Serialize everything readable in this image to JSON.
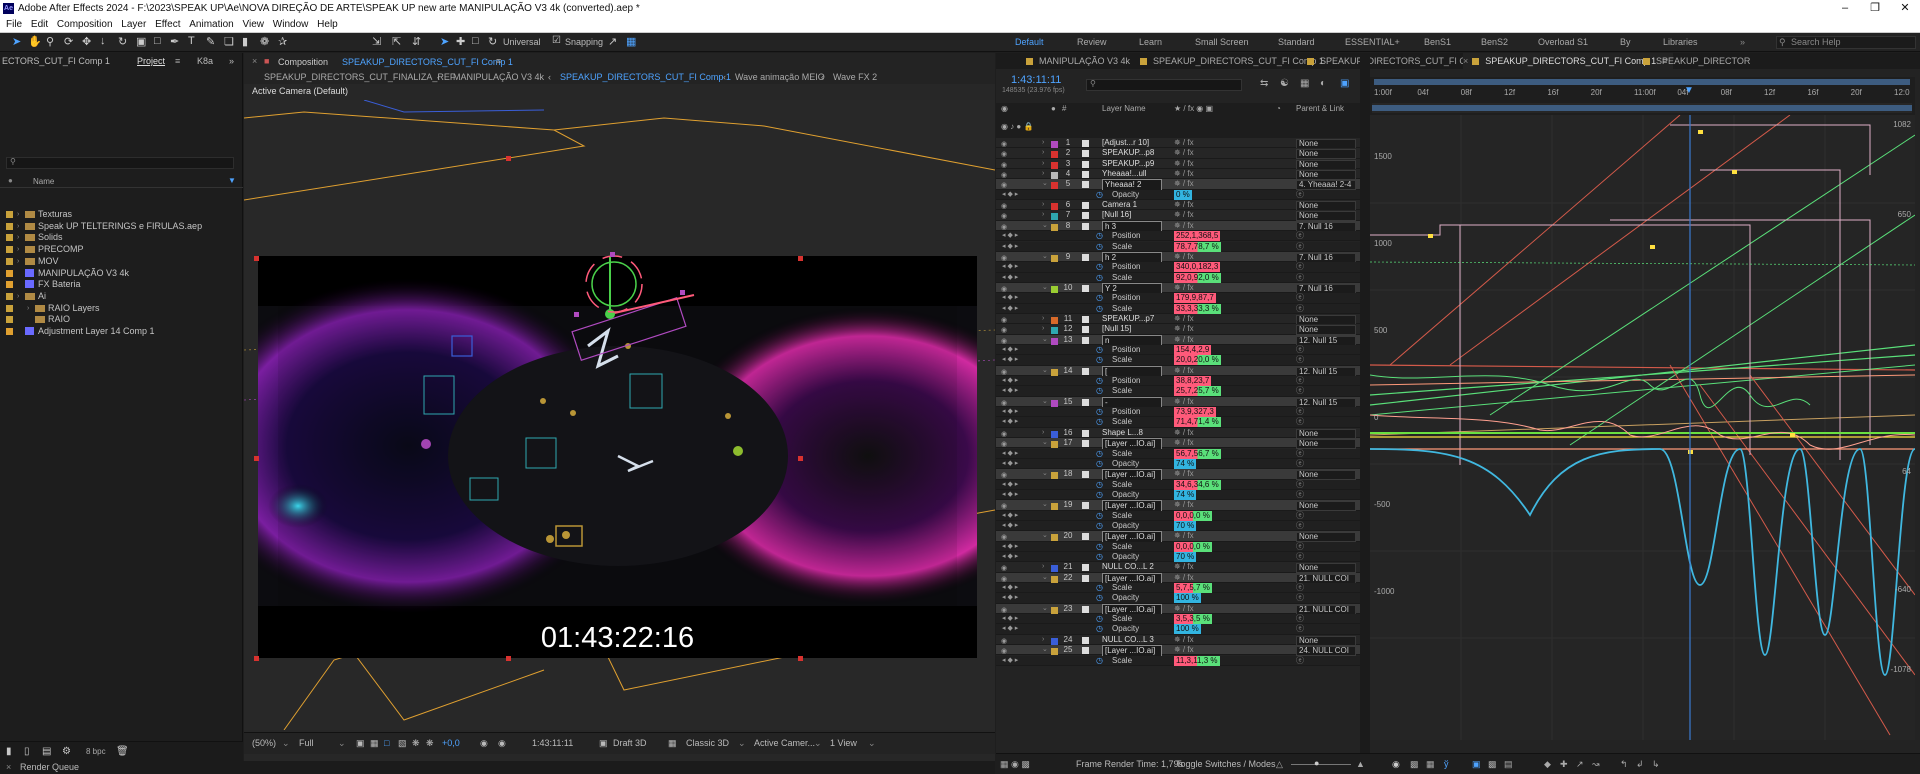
{
  "app": {
    "title": "Adobe After Effects 2024 - F:\\2023\\SPEAK UP\\Ae\\NOVA DIREÇÃO DE ARTE\\SPEAK UP new arte MANIPULAÇÃO V3 4k (converted).aep *",
    "logo": "Ae"
  },
  "menu": [
    "File",
    "Edit",
    "Composition",
    "Layer",
    "Effect",
    "Animation",
    "View",
    "Window",
    "Help"
  ],
  "toolbar": {
    "universal": "Universal",
    "snapping": "Snapping",
    "workspaces": [
      "Default",
      "Review",
      "Learn",
      "Small Screen",
      "Standard",
      "ESSENTIAL+",
      "BenS1",
      "BenS2",
      "Overload S1",
      "By",
      "Libraries"
    ],
    "active_workspace": "Default",
    "search_placeholder": "Search Help"
  },
  "project": {
    "tab_left": "ECTORS_CUT_FI Comp 1",
    "tab_project": "Project",
    "tab_k8a": "K8a",
    "col_name": "Name",
    "items": [
      {
        "name": "Texturas",
        "type": "folder",
        "color": "#c9a23b",
        "indent": 0
      },
      {
        "name": "Speak UP TELTERINGS e FIRULAS.aep",
        "type": "folder",
        "color": "#c9a23b",
        "indent": 0
      },
      {
        "name": "Solids",
        "type": "folder",
        "color": "#c9a23b",
        "indent": 0
      },
      {
        "name": "PRECOMP",
        "type": "folder",
        "color": "#c9a23b",
        "indent": 0
      },
      {
        "name": "MOV",
        "type": "folder",
        "color": "#c9a23b",
        "indent": 0
      },
      {
        "name": "MANIPULAÇÃO V3 4k",
        "type": "comp",
        "color": "#e0a030",
        "indent": 0
      },
      {
        "name": "FX Bateria",
        "type": "comp",
        "color": "#e0a030",
        "indent": 0
      },
      {
        "name": "Ai",
        "type": "folder",
        "color": "#c9a23b",
        "indent": 0
      },
      {
        "name": "RAIO Layers",
        "type": "folder",
        "color": "#c9a23b",
        "indent": 1
      },
      {
        "name": "RAIO",
        "type": "file",
        "color": "#c9a23b",
        "indent": 1
      },
      {
        "name": "Adjustment Layer 14 Comp 1",
        "type": "comp",
        "color": "#e0a030",
        "indent": 0
      }
    ],
    "bpc": "8 bpc"
  },
  "composition": {
    "header_prefix": "Composition",
    "header_name": "SPEAKUP_DIRECTORS_CUT_FI Comp 1",
    "breadcrumbs": [
      "SPEAKUP_DIRECTORS_CUT_FINALIZA_REF",
      "MANIPULAÇÃO V3 4k",
      "SPEAKUP_DIRECTORS_CUT_FI Comp 1",
      "Wave animação MEIO",
      "Wave FX 2"
    ],
    "active_breadcrumb": "SPEAKUP_DIRECTORS_CUT_FI Comp 1",
    "camera_label": "Active Camera (Default)",
    "timecode_overlay": "01:43:22:16",
    "zoom": "(50%)",
    "resolution": "Full",
    "exposure": "+0,0",
    "timecode": "1:43:11:11",
    "draft": "Draft 3D",
    "renderer": "Classic 3D",
    "camera": "Active Camer...",
    "views": "1 View"
  },
  "timeline": {
    "tabs": [
      "MANIPULAÇÃO V3 4k",
      "SPEAKUP_DIRECTORS_CUT_FI Comp 1",
      "SPEAKUP_DIRECTORS_CUT_FI Comp 1",
      "SPEAKUP_DIRECTORS_CUT_FI Comp 1",
      "SPEAKUP_DIRECTOR"
    ],
    "active_tab_index": 3,
    "current_time": "1:43:11:11",
    "frame_info": "148535 (23.976 fps)",
    "col_layer_name": "Layer Name",
    "col_parent": "Parent & Link",
    "ruler": [
      "1:00f",
      "04f",
      "08f",
      "12f",
      "16f",
      "20f",
      "11:00f",
      "04f",
      "08f",
      "12f",
      "16f",
      "20f",
      "12:0"
    ],
    "y_labels": [
      "1500",
      "1000",
      "500",
      "0",
      "-500",
      "-1000"
    ],
    "right_labels": [
      "1082",
      "650",
      "64",
      "-640",
      "-1078"
    ],
    "frame_render_time": "Frame Render Time: 1,79s",
    "toggle": "Toggle Switches / Modes"
  },
  "layers": [
    {
      "k": "L",
      "num": "1",
      "name": "[Adjust...r 10]",
      "color": "#b04ac0",
      "parent": "None"
    },
    {
      "k": "L",
      "num": "2",
      "name": "SPEAKUP...p8",
      "color": "#d8322f",
      "parent": "None"
    },
    {
      "k": "L",
      "num": "3",
      "name": "SPEAKUP...p9",
      "color": "#d8322f",
      "parent": "None"
    },
    {
      "k": "L",
      "num": "4",
      "name": "Yheaaa!...ull",
      "color": "#b8b8b8",
      "parent": "None"
    },
    {
      "k": "L",
      "num": "5",
      "name": "Yheaaa! 2",
      "color": "#d8322f",
      "parent": "4. Yheaaa! 2-4",
      "sel": true
    },
    {
      "k": "P",
      "name": "Opacity",
      "val": "0 %",
      "vc": "#32b4e0"
    },
    {
      "k": "L",
      "num": "6",
      "name": "Camera 1",
      "color": "#d8322f",
      "parent": "None"
    },
    {
      "k": "L",
      "num": "7",
      "name": "[Null 16]",
      "color": "#2fa8b0",
      "parent": "None"
    },
    {
      "k": "L",
      "num": "8",
      "name": "h 3",
      "color": "#c9a23b",
      "parent": "7. Null 16",
      "sel": true
    },
    {
      "k": "P",
      "name": "Position",
      "val": "252,1,368,5",
      "vc": "#ff5a7a"
    },
    {
      "k": "P",
      "name": "Scale",
      "val": "78,7,78,7 %",
      "vc": "#ff5a7a",
      "vc2": "#5ae07a"
    },
    {
      "k": "L",
      "num": "9",
      "name": "h 2",
      "color": "#c9a23b",
      "parent": "7. Null 16",
      "sel": true
    },
    {
      "k": "P",
      "name": "Position",
      "val": "340,0,182,3",
      "vc": "#ff5a7a"
    },
    {
      "k": "P",
      "name": "Scale",
      "val": "92,0,92,0 %",
      "vc": "#ff5a7a",
      "vc2": "#5ae07a"
    },
    {
      "k": "L",
      "num": "10",
      "name": "Y 2",
      "color": "#9acd32",
      "parent": "7. Null 16",
      "sel": true
    },
    {
      "k": "P",
      "name": "Position",
      "val": "179,9,87,7",
      "vc": "#ff5a7a"
    },
    {
      "k": "P",
      "name": "Scale",
      "val": "33,3,33,3 %",
      "vc": "#ff5a7a",
      "vc2": "#5ae07a"
    },
    {
      "k": "L",
      "num": "11",
      "name": "SPEAKUP...p7",
      "color": "#d86a2a",
      "parent": "None"
    },
    {
      "k": "L",
      "num": "12",
      "name": "[Null 15]",
      "color": "#2fa8b0",
      "parent": "None"
    },
    {
      "k": "L",
      "num": "13",
      "name": "n",
      "color": "#b04ac0",
      "parent": "12. Null 15",
      "sel": true
    },
    {
      "k": "P",
      "name": "Position",
      "val": "154,4,2,9",
      "vc": "#ff5a7a"
    },
    {
      "k": "P",
      "name": "Scale",
      "val": "20,0,20,0 %",
      "vc": "#ff5a7a",
      "vc2": "#5ae07a"
    },
    {
      "k": "L",
      "num": "14",
      "name": "[",
      "color": "#c9a23b",
      "parent": "12. Null 15",
      "sel": true
    },
    {
      "k": "P",
      "name": "Position",
      "val": "38,8,23,7",
      "vc": "#ff5a7a"
    },
    {
      "k": "P",
      "name": "Scale",
      "val": "25,7,25,7 %",
      "vc": "#ff5a7a",
      "vc2": "#5ae07a"
    },
    {
      "k": "L",
      "num": "15",
      "name": "-",
      "color": "#b04ac0",
      "parent": "12. Null 15",
      "sel": true
    },
    {
      "k": "P",
      "name": "Position",
      "val": "73,9,327,3",
      "vc": "#ff5a7a"
    },
    {
      "k": "P",
      "name": "Scale",
      "val": "71,4,71,4 %",
      "vc": "#ff5a7a",
      "vc2": "#5ae07a"
    },
    {
      "k": "L",
      "num": "16",
      "name": "Shape L...8",
      "color": "#3a5ed8",
      "parent": "None"
    },
    {
      "k": "L",
      "num": "17",
      "name": "[Layer ...IO.ai]",
      "color": "#c9a23b",
      "parent": "None",
      "sel": true
    },
    {
      "k": "P",
      "name": "Scale",
      "val": "56,7,56,7 %",
      "vc": "#ff5a7a",
      "vc2": "#5ae07a"
    },
    {
      "k": "P",
      "name": "Opacity",
      "val": "74 %",
      "vc": "#32b4e0"
    },
    {
      "k": "L",
      "num": "18",
      "name": "[Layer ...IO.ai]",
      "color": "#c9a23b",
      "parent": "None",
      "sel": true
    },
    {
      "k": "P",
      "name": "Scale",
      "val": "34,6,34,6 %",
      "vc": "#ff5a7a",
      "vc2": "#5ae07a"
    },
    {
      "k": "P",
      "name": "Opacity",
      "val": "74 %",
      "vc": "#32b4e0"
    },
    {
      "k": "L",
      "num": "19",
      "name": "[Layer ...IO.ai]",
      "color": "#c9a23b",
      "parent": "None",
      "sel": true
    },
    {
      "k": "P",
      "name": "Scale",
      "val": "0,0,0,0 %",
      "vc": "#ff5a7a",
      "vc2": "#5ae07a"
    },
    {
      "k": "P",
      "name": "Opacity",
      "val": "70 %",
      "vc": "#32b4e0"
    },
    {
      "k": "L",
      "num": "20",
      "name": "[Layer ...IO.ai]",
      "color": "#c9a23b",
      "parent": "None",
      "sel": true
    },
    {
      "k": "P",
      "name": "Scale",
      "val": "0,0,0,0 %",
      "vc": "#ff5a7a",
      "vc2": "#5ae07a"
    },
    {
      "k": "P",
      "name": "Opacity",
      "val": "70 %",
      "vc": "#32b4e0"
    },
    {
      "k": "L",
      "num": "21",
      "name": "NULL CO...L 2",
      "color": "#3a5ed8",
      "parent": "None"
    },
    {
      "k": "L",
      "num": "22",
      "name": "[Layer ...IO.ai]",
      "color": "#c9a23b",
      "parent": "21. NULL COI",
      "sel": true
    },
    {
      "k": "P",
      "name": "Scale",
      "val": "5,7,5,7 %",
      "vc": "#ff5a7a",
      "vc2": "#5ae07a"
    },
    {
      "k": "P",
      "name": "Opacity",
      "val": "100 %",
      "vc": "#32b4e0"
    },
    {
      "k": "L",
      "num": "23",
      "name": "[Layer ...IO.ai]",
      "color": "#c9a23b",
      "parent": "21. NULL COI",
      "sel": true
    },
    {
      "k": "P",
      "name": "Scale",
      "val": "3,5,3,5 %",
      "vc": "#ff5a7a",
      "vc2": "#5ae07a"
    },
    {
      "k": "P",
      "name": "Opacity",
      "val": "100 %",
      "vc": "#32b4e0"
    },
    {
      "k": "L",
      "num": "24",
      "name": "NULL CO...L 3",
      "color": "#3a5ed8",
      "parent": "None"
    },
    {
      "k": "L",
      "num": "25",
      "name": "[Layer ...IO.ai]",
      "color": "#c9a23b",
      "parent": "24. NULL COI",
      "sel": true
    },
    {
      "k": "P",
      "name": "Scale",
      "val": "11,3,11,3 %",
      "vc": "#ff5a7a",
      "vc2": "#5ae07a"
    }
  ],
  "render_queue": "Render Queue"
}
